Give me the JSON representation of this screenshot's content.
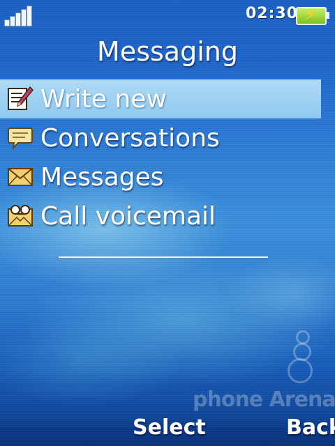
{
  "status_bar": {
    "time": "02:30",
    "signal_icon": "signal-strength-icon",
    "battery_icon": "battery-charging-icon"
  },
  "header": {
    "title": "Messaging"
  },
  "menu": {
    "items": [
      {
        "label": "Write new",
        "icon": "write-new-icon",
        "selected": true
      },
      {
        "label": "Conversations",
        "icon": "speech-bubble-icon",
        "selected": false
      },
      {
        "label": "Messages",
        "icon": "envelope-icon",
        "selected": false
      },
      {
        "label": "Call voicemail",
        "icon": "voicemail-icon",
        "selected": false
      }
    ]
  },
  "softkeys": {
    "left": "Select",
    "right": "Back"
  },
  "watermark": "phone Arena",
  "colors": {
    "background": "#1c63c9",
    "selection": "#bfe6fa",
    "text": "#ffffff",
    "battery": "#7ec01e"
  }
}
